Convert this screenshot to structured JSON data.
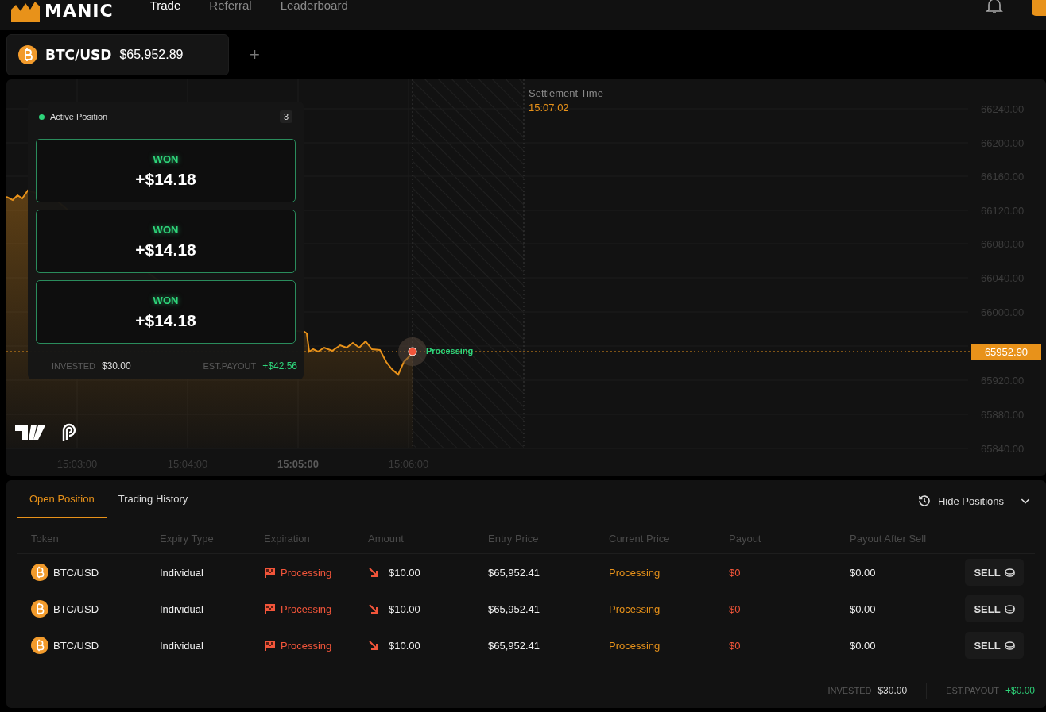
{
  "nav": {
    "logo": "MANIC",
    "links": [
      {
        "label": "Trade",
        "selected": true
      },
      {
        "label": "Referral",
        "selected": false
      },
      {
        "label": "Leaderboard",
        "selected": false
      }
    ]
  },
  "market_tabs": [
    {
      "symbol": "BTC/USD",
      "price": "$65,952.89"
    }
  ],
  "add_tab": "+",
  "chart": {
    "settlement_label": "Settlement Time",
    "settlement_time": "15:07:02",
    "y_ticks": [
      "66240.00",
      "66200.00",
      "66160.00",
      "66120.00",
      "66080.00",
      "66040.00",
      "66000.00",
      "65920.00",
      "65880.00",
      "65840.00"
    ],
    "x_ticks": [
      {
        "label": "15:03:00",
        "bold": false
      },
      {
        "label": "15:04:00",
        "bold": false
      },
      {
        "label": "15:05:00",
        "bold": true
      },
      {
        "label": "15:06:00",
        "bold": false
      }
    ],
    "current_price": "65952.90",
    "marker_label": "Processing"
  },
  "active_positions": {
    "title": "Active Position",
    "count": "3",
    "cards": [
      {
        "result": "WON",
        "amount": "+$14.18"
      },
      {
        "result": "WON",
        "amount": "+$14.18"
      },
      {
        "result": "WON",
        "amount": "+$14.18"
      }
    ],
    "invested_label": "INVESTED",
    "invested": "$30.00",
    "payout_label": "EST.PAYOUT",
    "payout": "+$42.56"
  },
  "positions": {
    "tabs": [
      {
        "label": "Open Position",
        "selected": true
      },
      {
        "label": "Trading History",
        "selected": false
      }
    ],
    "hide_button": "Hide Positions",
    "columns": [
      "Token",
      "Expiry Type",
      "Expiration",
      "Amount",
      "Entry Price",
      "Current Price",
      "Payout",
      "Payout After Sell"
    ],
    "rows": [
      {
        "token": "BTC/USD",
        "expiry_type": "Individual",
        "expiration": "Processing",
        "amount": "$10.00",
        "entry_price": "$65,952.41",
        "current_price": "Processing",
        "payout": "$0",
        "payout_after_sell": "$0.00",
        "action": "SELL"
      },
      {
        "token": "BTC/USD",
        "expiry_type": "Individual",
        "expiration": "Processing",
        "amount": "$10.00",
        "entry_price": "$65,952.41",
        "current_price": "Processing",
        "payout": "$0",
        "payout_after_sell": "$0.00",
        "action": "SELL"
      },
      {
        "token": "BTC/USD",
        "expiry_type": "Individual",
        "expiration": "Processing",
        "amount": "$10.00",
        "entry_price": "$65,952.41",
        "current_price": "Processing",
        "payout": "$0",
        "payout_after_sell": "$0.00",
        "action": "SELL"
      }
    ],
    "invested_label": "INVESTED",
    "invested": "$30.00",
    "payout_label": "EST.PAYOUT",
    "payout": "+$0.00"
  }
}
